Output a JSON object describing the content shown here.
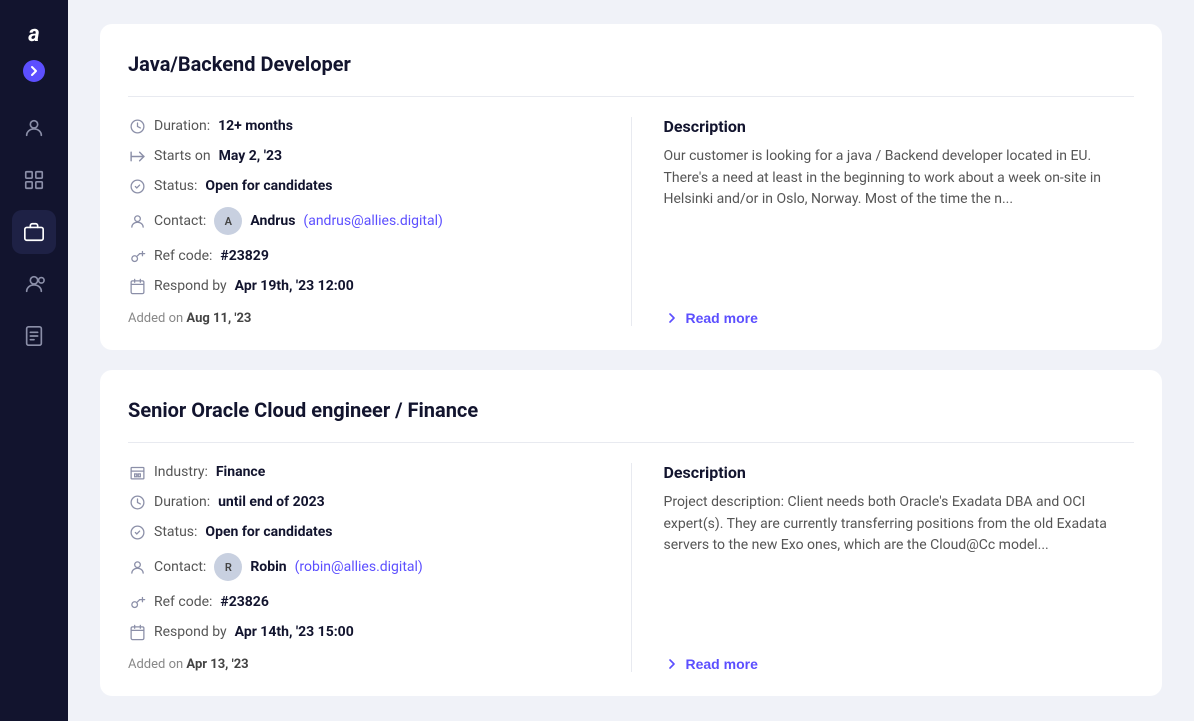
{
  "sidebar": {
    "logo": "a",
    "nav_items": [
      {
        "id": "people",
        "label": "People"
      },
      {
        "id": "dashboard",
        "label": "Dashboard"
      },
      {
        "id": "jobs",
        "label": "Jobs",
        "active": true
      },
      {
        "id": "candidates",
        "label": "Candidates"
      },
      {
        "id": "documents",
        "label": "Documents"
      }
    ]
  },
  "cards": [
    {
      "id": "card1",
      "title": "Java/Backend Developer",
      "fields": [
        {
          "icon": "clock",
          "label": "Duration:",
          "value": "12+ months"
        },
        {
          "icon": "arrow-right",
          "label": "Starts on",
          "value": "May 2, '23"
        },
        {
          "icon": "circle-check",
          "label": "Status:",
          "value": "Open for candidates"
        },
        {
          "icon": "person",
          "label": "Contact:",
          "contact": true,
          "name": "Andrus",
          "email": "(andrus@allies.digital)"
        },
        {
          "icon": "key",
          "label": "Ref code:",
          "value": "#23829"
        },
        {
          "icon": "calendar",
          "label": "Respond by",
          "value": "Apr 19th, '23 12:00"
        }
      ],
      "added_label": "Added on",
      "added_value": "Aug 11, '23",
      "description_title": "Description",
      "description_text": "Our customer is looking for a java / Backend developer located in EU. There's a need at least in the beginning to work about a week on-site in Helsinki and/or in Oslo, Norway. Most of the time the n...",
      "read_more": "Read more"
    },
    {
      "id": "card2",
      "title": "Senior Oracle Cloud engineer / Finance",
      "fields": [
        {
          "icon": "building",
          "label": "Industry:",
          "value": "Finance"
        },
        {
          "icon": "clock",
          "label": "Duration:",
          "value": "until end of 2023"
        },
        {
          "icon": "circle-check",
          "label": "Status:",
          "value": "Open for candidates"
        },
        {
          "icon": "person",
          "label": "Contact:",
          "contact": true,
          "name": "Robin",
          "email": "(robin@allies.digital)"
        },
        {
          "icon": "key",
          "label": "Ref code:",
          "value": "#23826"
        },
        {
          "icon": "calendar",
          "label": "Respond by",
          "value": "Apr 14th, '23 15:00"
        }
      ],
      "added_label": "Added on",
      "added_value": "Apr 13, '23",
      "description_title": "Description",
      "description_text": "Project description: Client needs both Oracle's Exadata DBA and OCI expert(s). They are currently transferring positions from the old Exadata servers to the new Exo ones, which are the Cloud@Cc model...",
      "read_more": "Read more"
    }
  ]
}
